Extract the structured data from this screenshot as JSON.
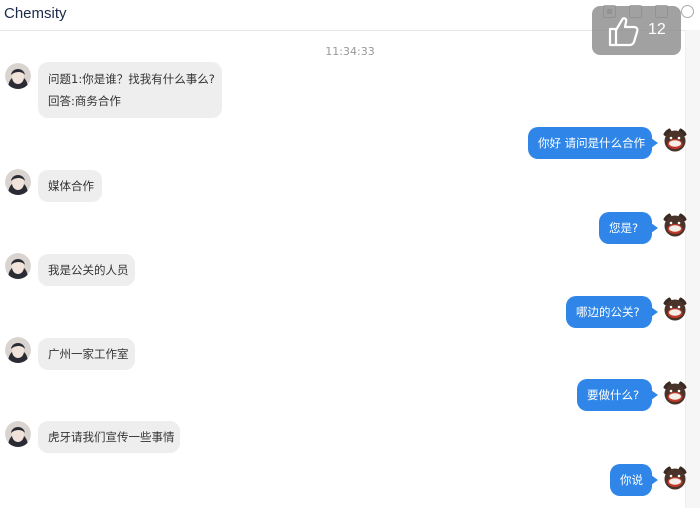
{
  "header": {
    "title": "Chemsity"
  },
  "like_badge": {
    "count": "12"
  },
  "chat": {
    "timestamp": "11:34:33",
    "messages": [
      {
        "side": "left",
        "lines": [
          "问题1:你是谁？找我有什么事么?",
          "回答:商务合作"
        ]
      },
      {
        "side": "right",
        "lines": [
          "你好 请问是什么合作"
        ]
      },
      {
        "side": "left",
        "lines": [
          "媒体合作"
        ]
      },
      {
        "side": "right",
        "lines": [
          "您是?"
        ]
      },
      {
        "side": "left",
        "lines": [
          "我是公关的人员"
        ]
      },
      {
        "side": "right",
        "lines": [
          "哪边的公关?"
        ]
      },
      {
        "side": "left",
        "lines": [
          "广州一家工作室"
        ]
      },
      {
        "side": "right",
        "lines": [
          "要做什么?"
        ]
      },
      {
        "side": "left",
        "lines": [
          "虎牙请我们宣传一些事情"
        ]
      },
      {
        "side": "right",
        "lines": [
          "你说"
        ]
      }
    ]
  },
  "colors": {
    "outgoing_bubble": "#2f86e8",
    "incoming_bubble": "#eeeeee"
  },
  "icons": {
    "like": "thumbs-up-icon",
    "window_controls": [
      "image-icon",
      "crop-icon",
      "plus-box-icon",
      "settings-icon"
    ]
  }
}
